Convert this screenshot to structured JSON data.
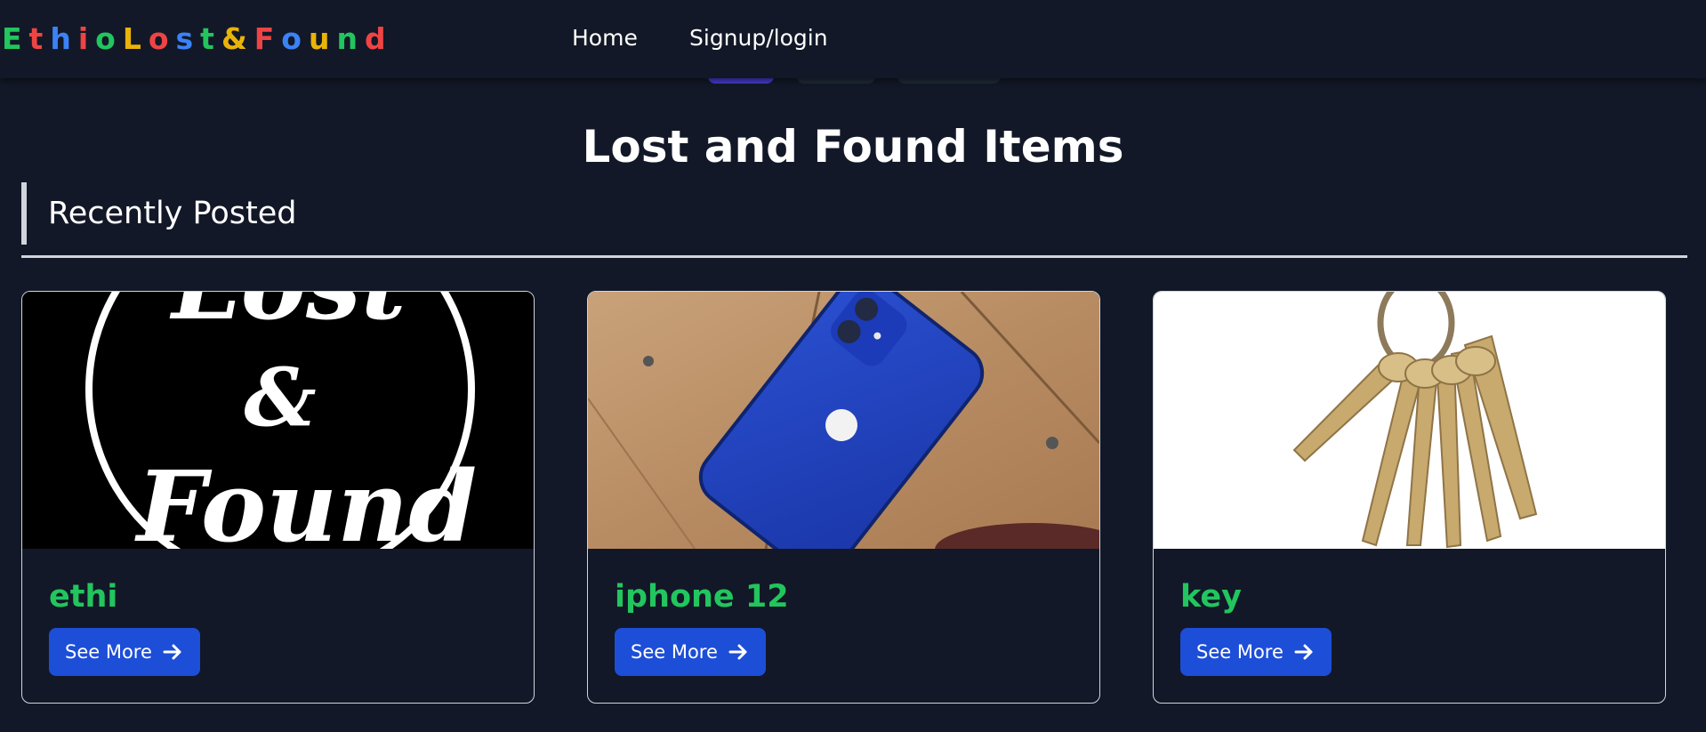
{
  "navbar": {
    "logo_letters": [
      {
        "char": "E",
        "color": "#22c55e"
      },
      {
        "char": "t",
        "color": "#ef4444"
      },
      {
        "char": "h",
        "color": "#3b82f6"
      },
      {
        "char": "i",
        "color": "#ef4444"
      },
      {
        "char": "o",
        "color": "#22c55e"
      },
      {
        "char": "L",
        "color": "#eab308"
      },
      {
        "char": "o",
        "color": "#ef4444"
      },
      {
        "char": "s",
        "color": "#3b82f6"
      },
      {
        "char": "t",
        "color": "#22c55e"
      },
      {
        "char": "&",
        "color": "#eab308"
      },
      {
        "char": "F",
        "color": "#ef4444"
      },
      {
        "char": "o",
        "color": "#3b82f6"
      },
      {
        "char": "u",
        "color": "#eab308"
      },
      {
        "char": "n",
        "color": "#22c55e"
      },
      {
        "char": "d",
        "color": "#ef4444"
      }
    ],
    "links": {
      "home": "Home",
      "signup": "Signup/login"
    }
  },
  "main": {
    "title": "Lost and Found Items",
    "section_heading": "Recently Posted",
    "cards": [
      {
        "title": "ethi",
        "button_label": "See More",
        "image_icon": "lost-and-found-logo-image"
      },
      {
        "title": "iphone 12",
        "button_label": "See More",
        "image_icon": "iphone-image"
      },
      {
        "title": "key",
        "button_label": "See More",
        "image_icon": "keys-image"
      }
    ]
  },
  "colors": {
    "background": "#121827",
    "card_title": "#22c55e",
    "button": "#1d4ed8",
    "active_pill": "#4338ca"
  }
}
